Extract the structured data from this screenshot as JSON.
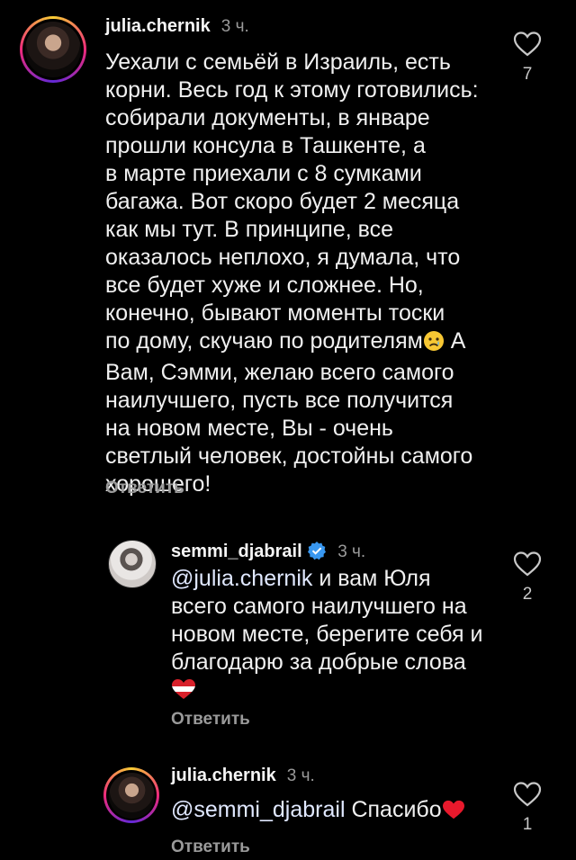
{
  "comments": [
    {
      "username": "julia.chernik",
      "time": "3 ч.",
      "lines": [
        "Уехали с семьёй в Израиль, есть",
        "корни. Весь год к этому готовились:",
        "собирали документы, в январе",
        "прошли консула в Ташкенте, а",
        "в марте приехали с 8 сумками",
        "багажа. Вот скоро будет 2 месяца",
        "как мы тут. В принципе, все",
        "оказалось неплохо, я думала, что",
        "все будет хуже и сложнее. Но,",
        "конечно, бывают моменты тоски",
        "по дому, скучаю по родителям",
        "Вам, Сэмми, желаю всего самого",
        "наилучшего, пусть все получится",
        "на новом месте, Вы - очень",
        "светлый человек, достойны самого",
        "хорошего!"
      ],
      "line11_tail": " А",
      "reply_label": "Ответить",
      "like_count": "7",
      "emoji": "crying-face-icon"
    },
    {
      "username": "semmi_djabrail",
      "time": "3 ч.",
      "mention": "@julia.chernik",
      "lines": [
        " и вам Юля",
        "всего самого наилучшего на",
        "новом месте, берегите себя и",
        "благодарю за добрые слова"
      ],
      "reply_label": "Ответить",
      "like_count": "2",
      "emoji": "heart-flag-icon",
      "verified": true
    },
    {
      "username": "julia.chernik",
      "time": "3 ч.",
      "mention": "@semmi_djabrail",
      "text": " Спасибо",
      "reply_label": "Ответить",
      "like_count": "1",
      "emoji": "red-heart-icon"
    }
  ],
  "colors": {
    "background": "#000000",
    "text": "#f0f0f0",
    "muted": "#9a9a9a",
    "verified": "#3897f0"
  }
}
